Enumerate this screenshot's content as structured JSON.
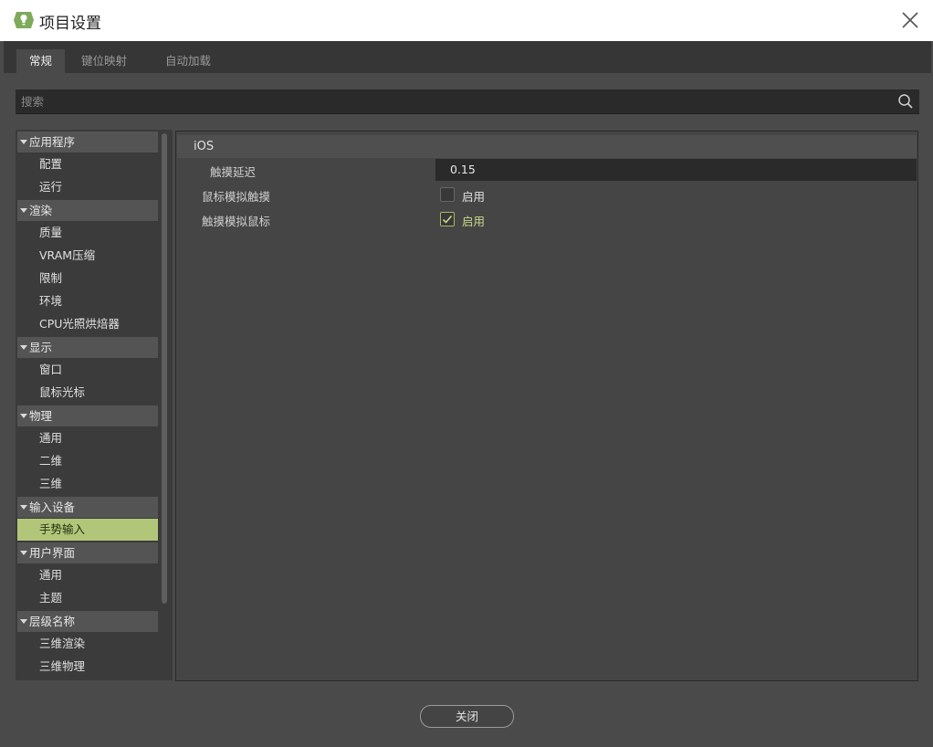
{
  "window": {
    "title": "项目设置"
  },
  "tabs": [
    {
      "label": "常规",
      "active": true
    },
    {
      "label": "键位映射",
      "active": false
    },
    {
      "label": "自动加载",
      "active": false
    }
  ],
  "search": {
    "placeholder": "搜索",
    "value": ""
  },
  "sidebar": {
    "groups": [
      {
        "label": "应用程序",
        "items": [
          "配置",
          "运行"
        ]
      },
      {
        "label": "渲染",
        "items": [
          "质量",
          "VRAM压缩",
          "限制",
          "环境",
          "CPU光照烘焙器"
        ]
      },
      {
        "label": "显示",
        "items": [
          "窗口",
          "鼠标光标"
        ]
      },
      {
        "label": "物理",
        "items": [
          "通用",
          "二维",
          "三维"
        ]
      },
      {
        "label": "输入设备",
        "items": [
          "手势输入"
        ]
      },
      {
        "label": "用户界面",
        "items": [
          "通用",
          "主题"
        ]
      },
      {
        "label": "层级名称",
        "items": [
          "三维渲染",
          "三维物理"
        ]
      }
    ],
    "selected": "手势输入"
  },
  "panel": {
    "section_title": "iOS",
    "properties": [
      {
        "label": "触摸延迟",
        "value": "0.15"
      },
      {
        "label": "鼠标模拟触摸",
        "checkbox_label": "启用",
        "checked": false
      },
      {
        "label": "触摸模拟鼠标",
        "checkbox_label": "启用",
        "checked": true
      }
    ]
  },
  "footer": {
    "close_label": "关闭"
  },
  "colors": {
    "accent": "#b2c67a",
    "background": "#4a4a4a",
    "titlebar": "#ffffff"
  }
}
